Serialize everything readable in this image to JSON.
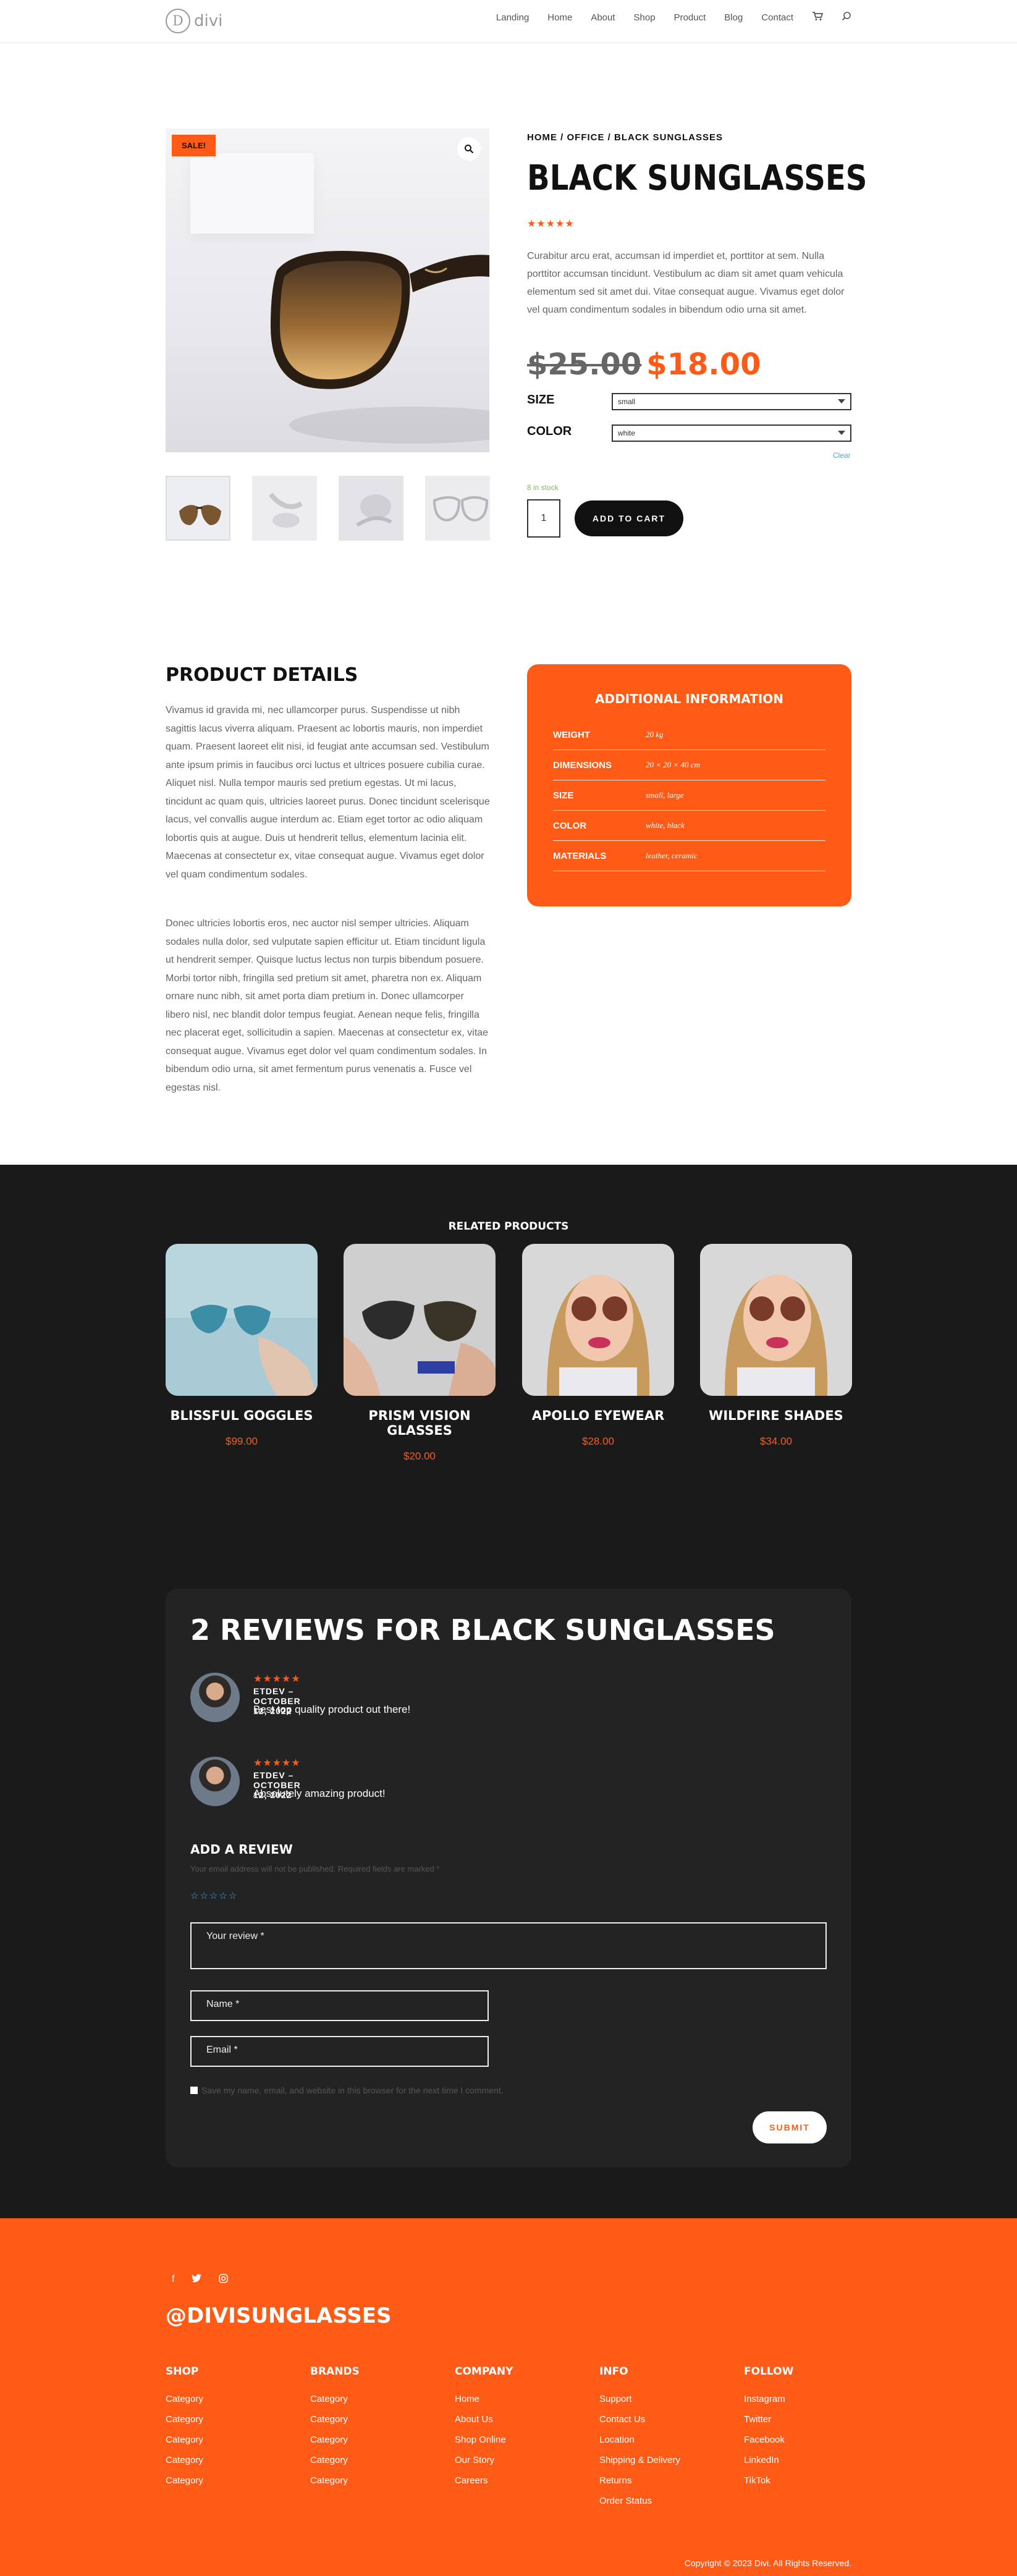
{
  "header": {
    "logo_letter": "D",
    "logo_text": "divi",
    "nav": [
      "Landing",
      "Home",
      "About",
      "Shop",
      "Product",
      "Blog",
      "Contact"
    ],
    "icons": [
      "cart-icon",
      "search-icon"
    ]
  },
  "product": {
    "sale_badge": "SALE!",
    "breadcrumb": "HOME / OFFICE / BLACK SUNGLASSES",
    "title": "BLACK SUNGLASSES",
    "stars": "★★★★★",
    "description": "Curabitur arcu erat, accumsan id imperdiet et, porttitor at sem. Nulla porttitor accumsan tincidunt. Vestibulum ac diam sit amet quam vehicula elementum sed sit amet dui. Vitae consequat augue. Vivamus eget dolor vel quam condimentum sodales in bibendum odio urna sit amet.",
    "old_price": "$25.00",
    "new_price": "$18.00",
    "size_label": "SIZE",
    "size_value": "small",
    "color_label": "COLOR",
    "color_value": "white",
    "clear": "Clear",
    "stock": "8 in stock",
    "qty": "1",
    "add_to_cart": "ADD TO CART"
  },
  "details": {
    "title": "PRODUCT DETAILS",
    "para1": "Vivamus id gravida mi, nec ullamcorper purus. Suspendisse ut nibh sagittis lacus viverra aliquam. Praesent ac lobortis mauris, non imperdiet quam. Praesent laoreet elit nisi, id feugiat ante accumsan sed. Vestibulum ante ipsum primis in faucibus orci luctus et ultrices posuere cubilia curae. Aliquet nisl. Nulla tempor mauris sed pretium egestas. Ut mi lacus, tincidunt ac quam quis, ultricies laoreet purus. Donec tincidunt scelerisque lacus, vel convallis augue interdum ac. Etiam eget tortor ac odio aliquam lobortis quis at augue. Duis ut hendrerit tellus, elementum lacinia elit. Maecenas at consectetur ex, vitae consequat augue. Vivamus eget dolor vel quam condimentum sodales.",
    "para2": "Donec ultricies lobortis eros, nec auctor nisl semper ultricies. Aliquam sodales nulla dolor, sed vulputate sapien efficitur ut. Etiam tincidunt ligula ut hendrerit semper. Quisque luctus lectus non turpis bibendum posuere. Morbi tortor nibh, fringilla sed pretium sit amet, pharetra non ex. Aliquam ornare nunc nibh, sit amet porta diam pretium in. Donec ullamcorper libero nisl, nec blandit dolor tempus feugiat. Aenean neque felis, fringilla nec placerat eget, sollicitudin a sapien. Maecenas at consectetur ex, vitae consequat augue. Vivamus eget dolor vel quam condimentum sodales. In bibendum odio urna, sit amet fermentum purus venenatis a. Fusce vel egestas nisl.",
    "info_title": "ADDITIONAL INFORMATION",
    "info": [
      {
        "k": "WEIGHT",
        "v": "20 kg"
      },
      {
        "k": "DIMENSIONS",
        "v": "20 × 20 × 40 cm"
      },
      {
        "k": "SIZE",
        "v": "small, large"
      },
      {
        "k": "COLOR",
        "v": "white, black"
      },
      {
        "k": "MATERIALS",
        "v": "leather, ceramic"
      }
    ]
  },
  "related": {
    "title": "RELATED PRODUCTS",
    "items": [
      {
        "name": "BLISSFUL GOGGLES",
        "price": "$99.00"
      },
      {
        "name": "PRISM VISION GLASSES",
        "price": "$20.00"
      },
      {
        "name": "APOLLO EYEWEAR",
        "price": "$28.00"
      },
      {
        "name": "WILDFIRE SHADES",
        "price": "$34.00"
      }
    ]
  },
  "reviews": {
    "title": "2 REVIEWS FOR BLACK SUNGLASSES",
    "items": [
      {
        "stars": "★★★★★",
        "meta": "ETDEV – OCTOBER 12, 2022",
        "text": "Best top quality product out there!"
      },
      {
        "stars": "★★★★★",
        "meta": "ETDEV – OCTOBER 12, 2022",
        "text": "Absolutely amazing product!"
      }
    ],
    "add_title": "ADD A REVIEW",
    "note": "Your email address will not be published. Required fields are marked *",
    "empty_stars": "☆☆☆☆☆",
    "review_placeholder": "Your review *",
    "name_placeholder": "Name *",
    "email_placeholder": "Email *",
    "consent": "Save my name, email, and website in this browser for the next time I comment.",
    "submit": "SUBMIT"
  },
  "footer": {
    "social_icons": [
      "facebook-icon",
      "twitter-icon",
      "instagram-icon"
    ],
    "handle": "@DIVISUNGLASSES",
    "columns": [
      {
        "h": "SHOP",
        "links": [
          "Category",
          "Category",
          "Category",
          "Category",
          "Category"
        ]
      },
      {
        "h": "BRANDS",
        "links": [
          "Category",
          "Category",
          "Category",
          "Category",
          "Category"
        ]
      },
      {
        "h": "COMPANY",
        "links": [
          "Home",
          "About Us",
          "Shop Online",
          "Our Story",
          "Careers"
        ]
      },
      {
        "h": "INFO",
        "links": [
          "Support",
          "Contact Us",
          "Location",
          "Shipping & Delivery",
          "Returns",
          "Order Status"
        ]
      },
      {
        "h": "FOLLOW",
        "links": [
          "Instagram",
          "Twitter",
          "Facebook",
          "LinkedIn",
          "TikTok"
        ]
      }
    ],
    "copyright": "Copyright © 2023 Divi. All Rights Reserved."
  },
  "colors": {
    "accent": "#ff5a16",
    "dark": "#1a1a1a",
    "card": "#232323"
  }
}
